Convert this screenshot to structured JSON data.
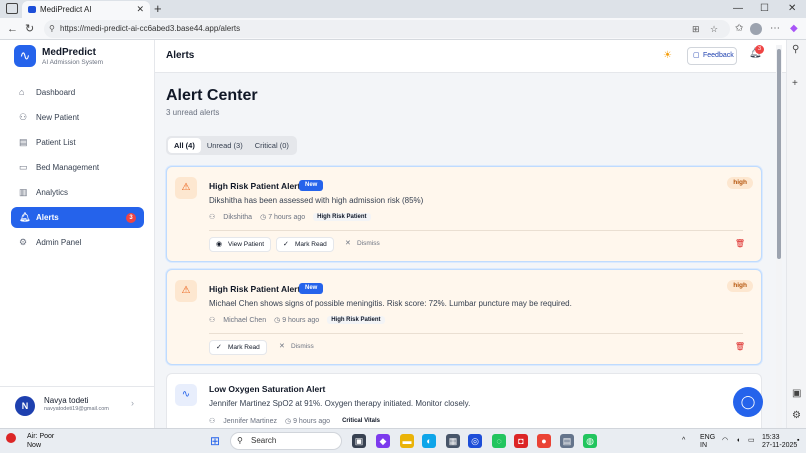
{
  "browser": {
    "tab_title": "MediPredict AI",
    "url": "https://medi-predict-ai-cc6abed3.base44.app/alerts"
  },
  "sidebar": {
    "brand_title": "MedPredict",
    "brand_subtitle": "AI Admission System",
    "items": [
      {
        "label": "Dashboard",
        "icon": "home-icon"
      },
      {
        "label": "New Patient",
        "icon": "user-plus-icon"
      },
      {
        "label": "Patient List",
        "icon": "clipboard-icon"
      },
      {
        "label": "Bed Management",
        "icon": "bed-icon"
      },
      {
        "label": "Analytics",
        "icon": "chart-icon"
      },
      {
        "label": "Alerts",
        "icon": "bell-icon",
        "badge": "3"
      },
      {
        "label": "Admin Panel",
        "icon": "gear-icon"
      }
    ],
    "user": {
      "initial": "N",
      "name": "Navya todeti",
      "email": "navyatodeti19@gmail.com"
    }
  },
  "topbar": {
    "title": "Alerts",
    "feedback_label": "Feedback",
    "bell_badge": "3"
  },
  "page": {
    "heading": "Alert Center",
    "subheading": "3 unread alerts",
    "filters": [
      "All (4)",
      "Unread (3)",
      "Critical (0)"
    ]
  },
  "alerts": [
    {
      "title": "High Risk Patient Alert",
      "badge": "New",
      "severity": "high",
      "message": "Dikshitha has been assessed with high admission risk (85%)",
      "patient": "Dikshitha",
      "time": "7 hours ago",
      "category": "High Risk Patient",
      "actions": {
        "view": "View Patient",
        "mark": "Mark Read",
        "dismiss": "Dismiss"
      }
    },
    {
      "title": "High Risk Patient Alert",
      "badge": "New",
      "severity": "high",
      "message": "Michael Chen shows signs of possible meningitis. Risk score: 72%. Lumbar puncture may be required.",
      "patient": "Michael Chen",
      "time": "9 hours ago",
      "category": "High Risk Patient",
      "actions": {
        "mark": "Mark Read",
        "dismiss": "Dismiss"
      }
    },
    {
      "title": "Low Oxygen Saturation Alert",
      "message": "Jennifer Martinez SpO2 at 91%. Oxygen therapy initiated. Monitor closely.",
      "patient": "Jennifer Martinez",
      "time": "9 hours ago",
      "category": "Critical Vitals"
    }
  ],
  "taskbar": {
    "weather_line1": "Air: Poor",
    "weather_line2": "Now",
    "search_placeholder": "Search",
    "lang1": "ENG",
    "lang2": "IN",
    "time": "15:33",
    "date": "27-11-2025"
  }
}
